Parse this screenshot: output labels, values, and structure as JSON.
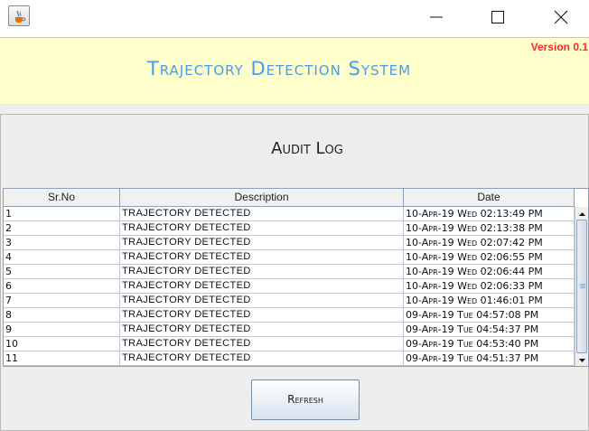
{
  "window": {
    "icon": "java-icon",
    "controls": [
      "minimize-icon",
      "maximize-icon",
      "close-icon"
    ]
  },
  "header": {
    "title": "Trajectory Detection System",
    "version": "Version 0.1",
    "title_color": "#4a9ee8",
    "version_color": "#ff2a2a",
    "background": "#ffffcc"
  },
  "main": {
    "title": "Audit Log"
  },
  "table": {
    "columns": [
      "Sr.No",
      "Description",
      "Date"
    ],
    "rows": [
      {
        "sr": "1",
        "description": "TRAJECTORY DETECTED",
        "date": "10-Apr-19 Wed 02:13:49 PM"
      },
      {
        "sr": "2",
        "description": "TRAJECTORY DETECTED",
        "date": "10-Apr-19 Wed 02:13:38 PM"
      },
      {
        "sr": "3",
        "description": "TRAJECTORY DETECTED",
        "date": "10-Apr-19 Wed 02:07:42 PM"
      },
      {
        "sr": "4",
        "description": "TRAJECTORY DETECTED",
        "date": "10-Apr-19 Wed 02:06:55 PM"
      },
      {
        "sr": "5",
        "description": "TRAJECTORY DETECTED",
        "date": "10-Apr-19 Wed 02:06:44 PM"
      },
      {
        "sr": "6",
        "description": "TRAJECTORY DETECTED",
        "date": "10-Apr-19 Wed 02:06:33 PM"
      },
      {
        "sr": "7",
        "description": "TRAJECTORY DETECTED",
        "date": "10-Apr-19 Wed 01:46:01 PM"
      },
      {
        "sr": "8",
        "description": "TRAJECTORY DETECTED",
        "date": "09-Apr-19 Tue 04:57:08 PM"
      },
      {
        "sr": "9",
        "description": "TRAJECTORY DETECTED",
        "date": "09-Apr-19 Tue 04:54:37 PM"
      },
      {
        "sr": "10",
        "description": "TRAJECTORY DETECTED",
        "date": "09-Apr-19 Tue 04:53:40 PM"
      },
      {
        "sr": "11",
        "description": "TRAJECTORY DETECTED",
        "date": "09-Apr-19 Tue 04:51:37 PM"
      }
    ]
  },
  "buttons": {
    "refresh": "Refresh"
  }
}
